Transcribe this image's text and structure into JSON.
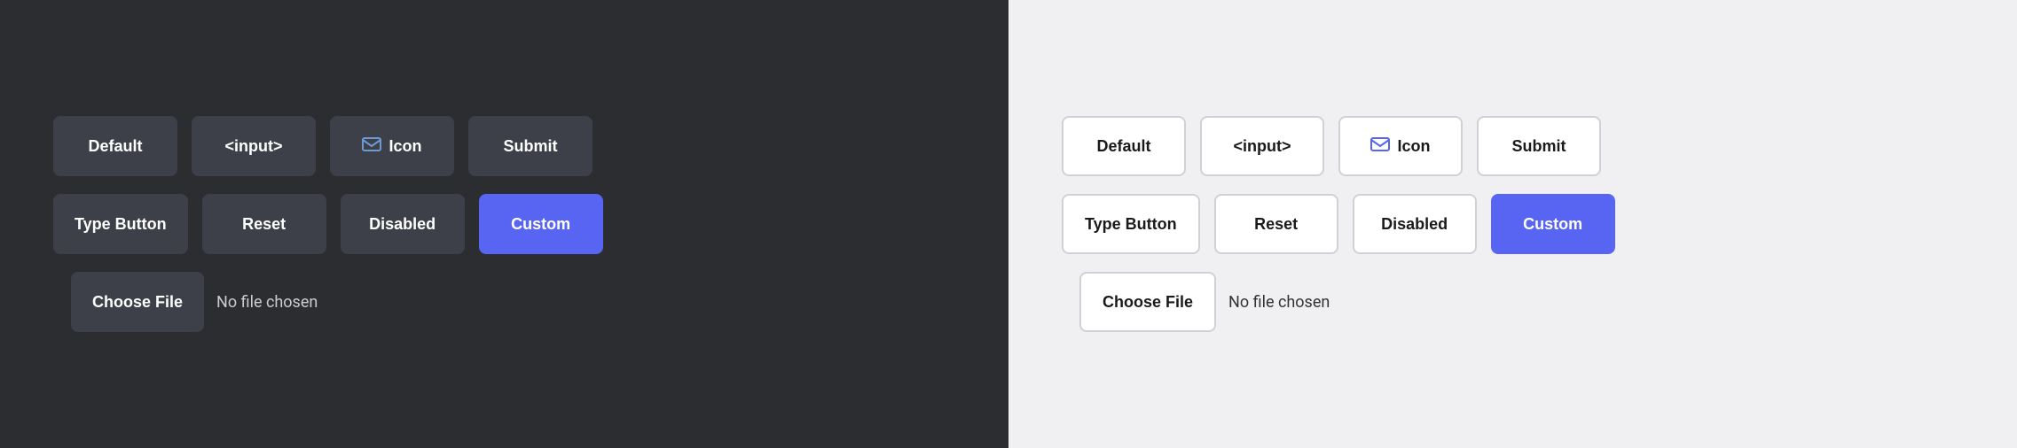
{
  "dark_panel": {
    "bg": "#2b2d31",
    "row1": {
      "buttons": [
        {
          "label": "Default",
          "type": "default",
          "name": "default-button-dark"
        },
        {
          "label": "<input>",
          "type": "default",
          "name": "input-button-dark"
        },
        {
          "label": "Icon",
          "type": "icon",
          "name": "icon-button-dark"
        },
        {
          "label": "Submit",
          "type": "default",
          "name": "submit-button-dark"
        }
      ]
    },
    "row2": {
      "buttons": [
        {
          "label": "Type Button",
          "type": "default",
          "name": "type-button-dark"
        },
        {
          "label": "Reset",
          "type": "default",
          "name": "reset-button-dark"
        },
        {
          "label": "Disabled",
          "type": "default",
          "name": "disabled-button-dark"
        },
        {
          "label": "Custom",
          "type": "custom",
          "name": "custom-button-dark"
        }
      ]
    },
    "file": {
      "btn_label": "Choose File",
      "file_label": "No file chosen"
    }
  },
  "light_panel": {
    "bg": "#f0f0f2",
    "row1": {
      "buttons": [
        {
          "label": "Default",
          "type": "default",
          "name": "default-button-light"
        },
        {
          "label": "<input>",
          "type": "default",
          "name": "input-button-light"
        },
        {
          "label": "Icon",
          "type": "icon",
          "name": "icon-button-light"
        },
        {
          "label": "Submit",
          "type": "default",
          "name": "submit-button-light"
        }
      ]
    },
    "row2": {
      "buttons": [
        {
          "label": "Type Button",
          "type": "default",
          "name": "type-button-light"
        },
        {
          "label": "Reset",
          "type": "default",
          "name": "reset-button-light"
        },
        {
          "label": "Disabled",
          "type": "default",
          "name": "disabled-button-light"
        },
        {
          "label": "Custom",
          "type": "custom",
          "name": "custom-button-light"
        }
      ]
    },
    "file": {
      "btn_label": "Choose File",
      "file_label": "No file chosen"
    }
  }
}
